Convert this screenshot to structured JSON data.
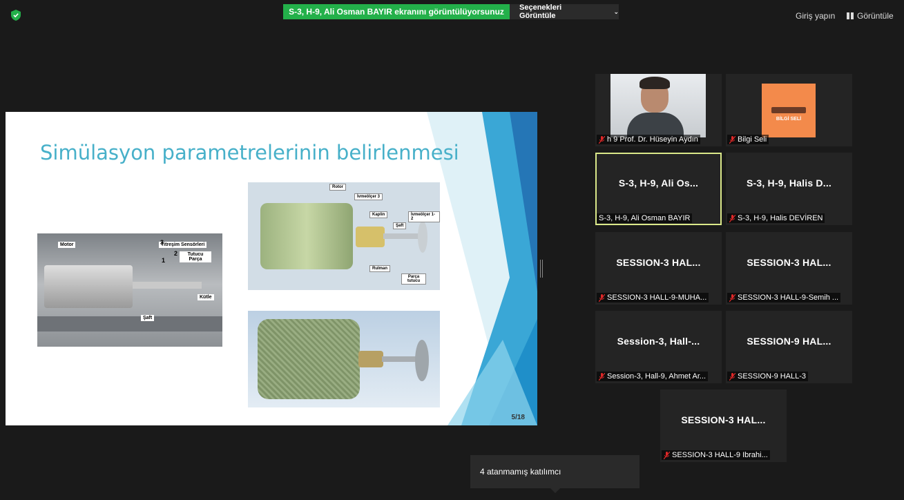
{
  "top_bar": {
    "share_banner": "S-3, H-9, Ali Osman BAYIR ekranını görüntülüyorsunuz",
    "view_options": "Seçenekleri Görüntüle",
    "signin": "Giriş yapın",
    "view": "Görüntüle",
    "shield_color": "#23b04a"
  },
  "slide": {
    "title": "Simülasyon parametrelerinin belirlenmesi",
    "page": "5/18",
    "photo_labels": {
      "motor": "Motor",
      "sensors": "Titreşim Sensörleri",
      "holder": "Tutucu Parça",
      "mass": "Kütle",
      "shaft": "Şaft",
      "num1": "1",
      "num2": "2",
      "num3": "3"
    },
    "render_labels": {
      "rotor": "Rotor",
      "acc3": "İvmeölçer 3",
      "coupling": "Kaplin",
      "shaft": "Şaft",
      "acc12": "İvmeölçer 1-2",
      "bearing": "Rulman",
      "holder": "Parça tutucu"
    }
  },
  "participants": [
    {
      "big": "",
      "name": "h 9 Prof. Dr. Hüseyin Aydın",
      "type": "video"
    },
    {
      "big": "",
      "name": "Bilgi Seli",
      "type": "logo",
      "logo_text": "BİLGİ SELİ"
    },
    {
      "big": "S-3, H-9, Ali Os...",
      "name": "S-3, H-9, Ali Osman BAYIR",
      "type": "active"
    },
    {
      "big": "S-3, H-9, Halis D...",
      "name": "S-3, H-9, Halis DEVİREN",
      "type": "text"
    },
    {
      "big": "SESSION-3  HAL...",
      "name": "SESSION-3 HALL-9-MUHA...",
      "type": "text"
    },
    {
      "big": "SESSION-3  HAL...",
      "name": "SESSION-3 HALL-9-Semih ...",
      "type": "text"
    },
    {
      "big": "Session-3,  Hall-...",
      "name": "Session-3, Hall-9, Ahmet Ar...",
      "type": "text"
    },
    {
      "big": "SESSION-9  HAL...",
      "name": "SESSION-9 HALL-3",
      "type": "text"
    },
    {
      "big": "SESSION-3  HAL...",
      "name": "SESSION-3 HALL-9  Ibrahi...",
      "type": "text"
    }
  ],
  "tooltip": "4 atanmamış katılımcı",
  "colors": {
    "mic_muted": "#e02828",
    "active_border": "#dbe98a",
    "accent": "#23b04a"
  }
}
